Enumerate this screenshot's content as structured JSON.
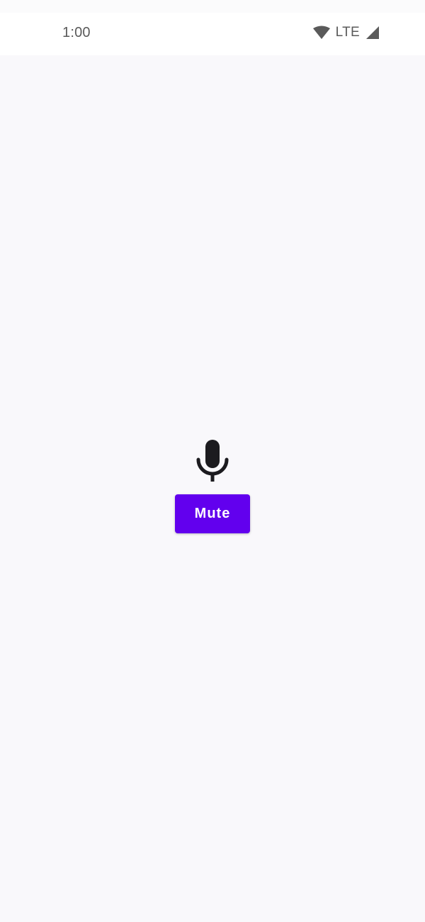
{
  "status_bar": {
    "time": "1:00",
    "network": "LTE",
    "icons": [
      "wifi-icon",
      "cell-signal-icon"
    ]
  },
  "main": {
    "icon": "microphone-icon",
    "mute_button_label": "Mute"
  },
  "colors": {
    "accent": "#6200ee",
    "background": "#f9f8fb",
    "icon": "#1c1b1f",
    "status_text": "#5a5a5a"
  }
}
